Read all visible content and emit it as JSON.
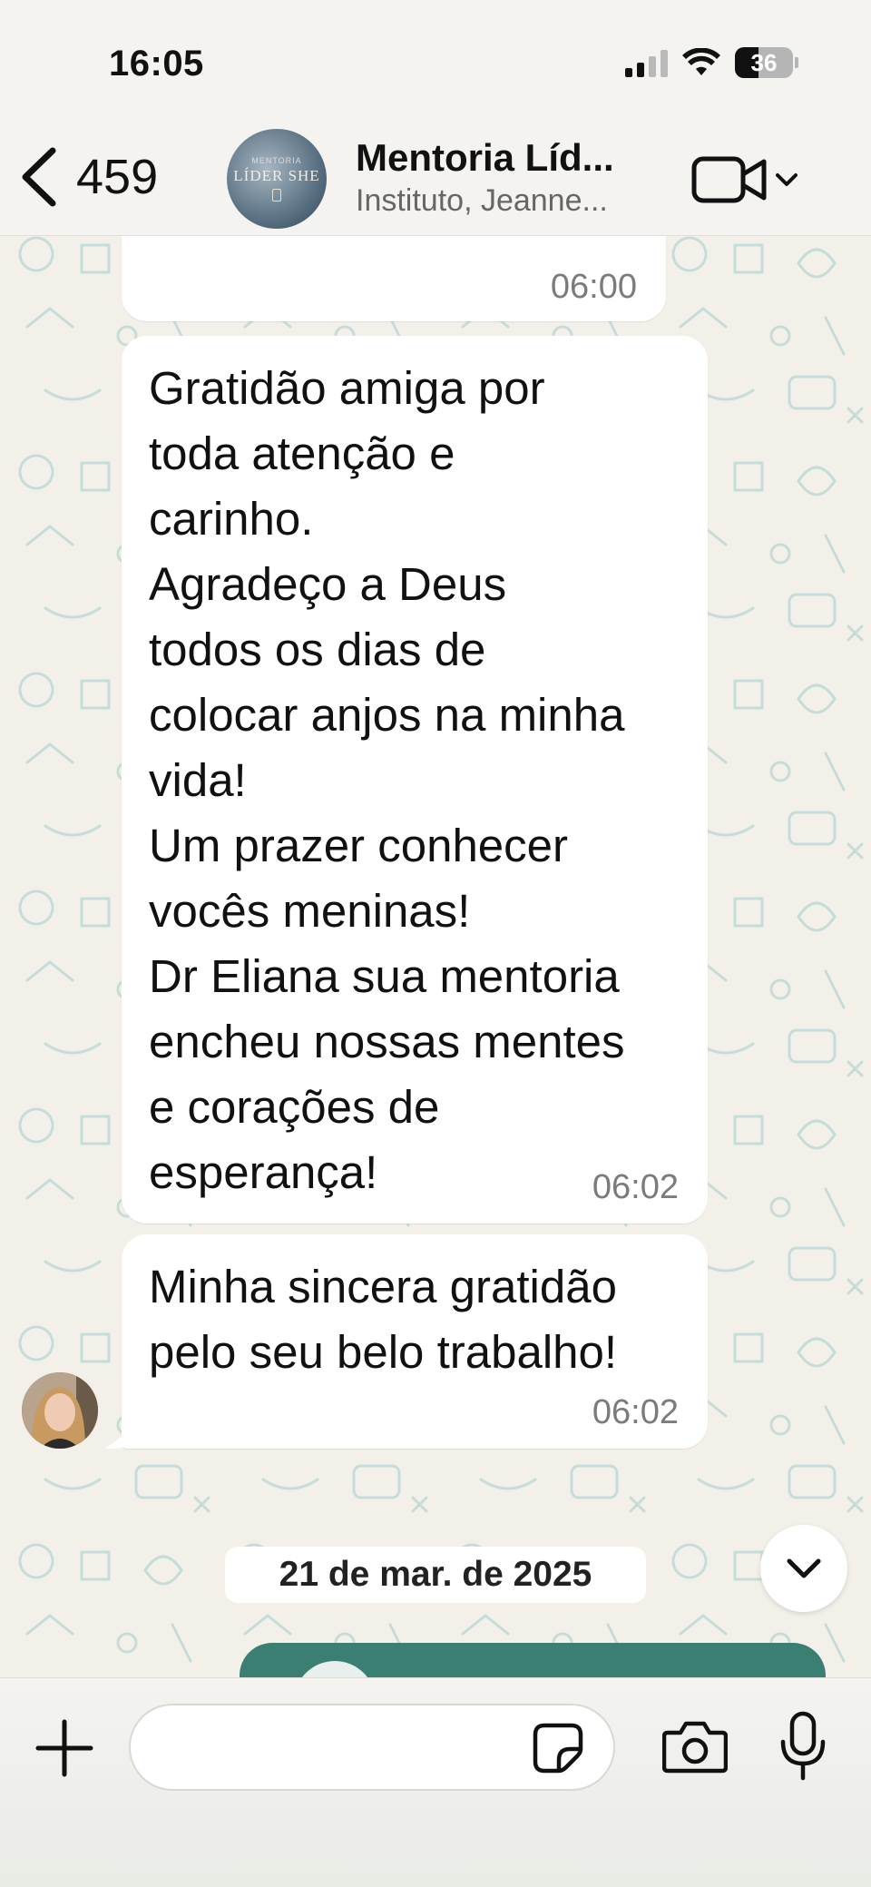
{
  "status_bar": {
    "time": "16:05",
    "battery": "36",
    "signal_icon": "signal-bars-icon",
    "wifi_icon": "wifi-icon"
  },
  "header": {
    "back_count": "459",
    "group_name": "Mentoria Líd...",
    "group_members": "Instituto, Jeanne...",
    "avatar_small": "MENTORIA",
    "avatar_main": "LÍDER SHE",
    "video_icon": "video-call-icon"
  },
  "messages": [
    {
      "time": "06:00"
    },
    {
      "text": "Gratidão  amiga por\ntoda atenção  e\ncarinho.\nAgradeço  a Deus\ntodos os dias de\ncolocar anjos na minha\nvida!\nUm prazer conhecer\nvocês meninas!\nDr Eliana sua mentoria\nencheu nossas mentes\ne corações  de\nesperança!",
      "time": "06:02"
    },
    {
      "text": "Minha sincera gratidão\npelo seu belo trabalho!",
      "time": "06:02"
    }
  ],
  "date_separator": "21 de mar. de 2025",
  "input": {
    "placeholder": "",
    "value": ""
  },
  "colors": {
    "accent": "#3a7f72",
    "bubble": "#ffffff",
    "wallpaper": "#f3f0ea"
  }
}
